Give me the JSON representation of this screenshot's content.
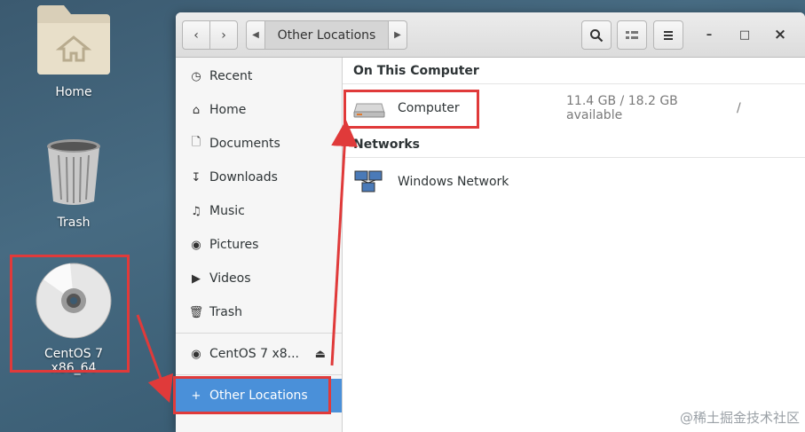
{
  "desktop": {
    "home_label": "Home",
    "trash_label": "Trash",
    "cd_label": "CentOS 7 x86_64"
  },
  "window": {
    "back_icon": "chevron-left-icon",
    "forward_icon": "chevron-right-icon",
    "path_current": "Other Locations",
    "search_icon": "search-icon",
    "view_icon": "list-view-icon",
    "menu_icon": "hamburger-menu-icon",
    "minimize": "–",
    "maximize": "□",
    "close": "×"
  },
  "sidebar": {
    "items": [
      {
        "label": "Recent",
        "icon": "clock-icon"
      },
      {
        "label": "Home",
        "icon": "home-icon"
      },
      {
        "label": "Documents",
        "icon": "document-icon"
      },
      {
        "label": "Downloads",
        "icon": "download-icon"
      },
      {
        "label": "Music",
        "icon": "music-icon"
      },
      {
        "label": "Pictures",
        "icon": "camera-icon"
      },
      {
        "label": "Videos",
        "icon": "video-icon"
      },
      {
        "label": "Trash",
        "icon": "trash-icon"
      }
    ],
    "device": {
      "label": "CentOS 7 x8...",
      "icon": "disc-icon",
      "eject_icon": "eject-icon"
    },
    "other": {
      "label": "Other Locations",
      "icon": "plus-icon"
    }
  },
  "main": {
    "on_this_computer": "On This Computer",
    "computer": {
      "name": "Computer",
      "info": "11.4 GB / 18.2 GB available",
      "path": "/"
    },
    "networks": "Networks",
    "windows_network": {
      "name": "Windows Network"
    }
  },
  "watermark": "@稀土掘金技术社区",
  "colors": {
    "accent": "#4a90d9",
    "highlight": "#e03a3a"
  }
}
